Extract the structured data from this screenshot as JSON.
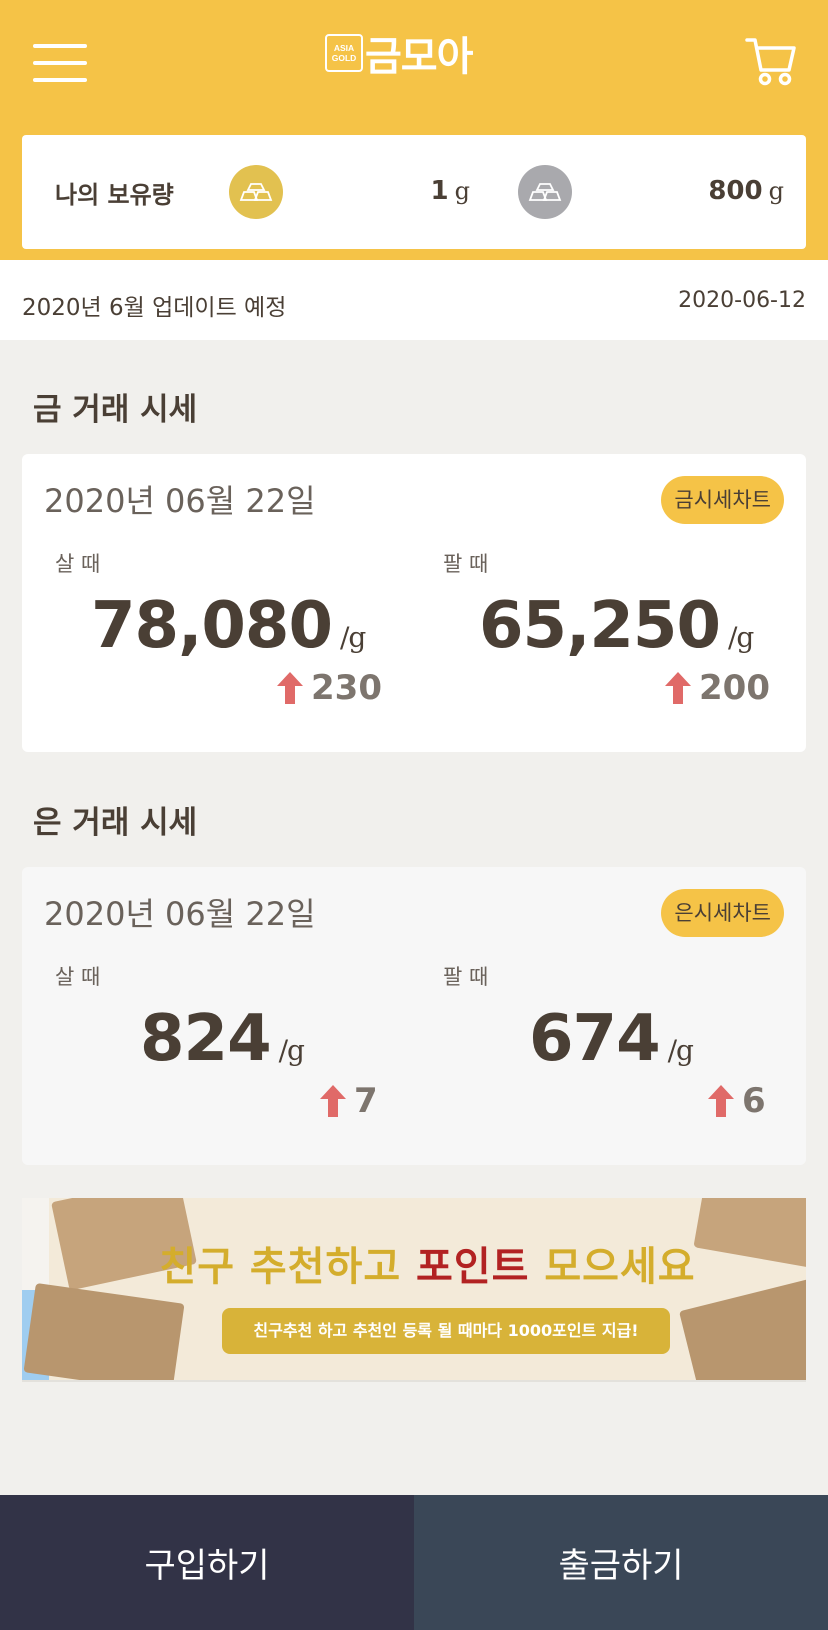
{
  "header": {
    "logo_badge": "ASIA GOLD",
    "logo_text": "금모아",
    "menu_icon": "hamburger-menu-icon",
    "cart_icon": "cart-icon",
    "bg_color": "#f5c347"
  },
  "holdings": {
    "label": "나의 보유량",
    "gold": {
      "amount": "1",
      "unit": "g",
      "icon": "gold-bar-icon"
    },
    "silver": {
      "amount": "800",
      "unit": "g",
      "icon": "silver-bar-icon"
    }
  },
  "notice": {
    "text": "2020년 6월 업데이트 예정",
    "date": "2020-06-12"
  },
  "gold_section": {
    "title": "금 거래 시세",
    "date": "2020년 06월 22일",
    "chart_button": "금시세차트",
    "buy_label": "살 때",
    "buy_price": "78,080",
    "buy_unit": "/g",
    "buy_change": "230",
    "sell_label": "팔 때",
    "sell_price": "65,250",
    "sell_unit": "/g",
    "sell_change": "200"
  },
  "silver_section": {
    "title": "은 거래 시세",
    "date": "2020년 06월 22일",
    "chart_button": "은시세차트",
    "buy_label": "살 때",
    "buy_price": "824",
    "buy_unit": "/g",
    "buy_change": "7",
    "sell_label": "팔 때",
    "sell_price": "674",
    "sell_unit": "/g",
    "sell_change": "6"
  },
  "banner": {
    "headline_a": "친구 추천하고 ",
    "headline_b": "포인트",
    "headline_c": " 모으세요",
    "subtext": "친구추천 하고 추천인 등록 될 때마다 1000포인트 지급!"
  },
  "bottom": {
    "buy_label": "구입하기",
    "withdraw_label": "출금하기"
  },
  "colors": {
    "accent": "#f5c347",
    "up_arrow": "#e06a68",
    "buy_button": "#323347",
    "withdraw_button": "#3a4757"
  }
}
